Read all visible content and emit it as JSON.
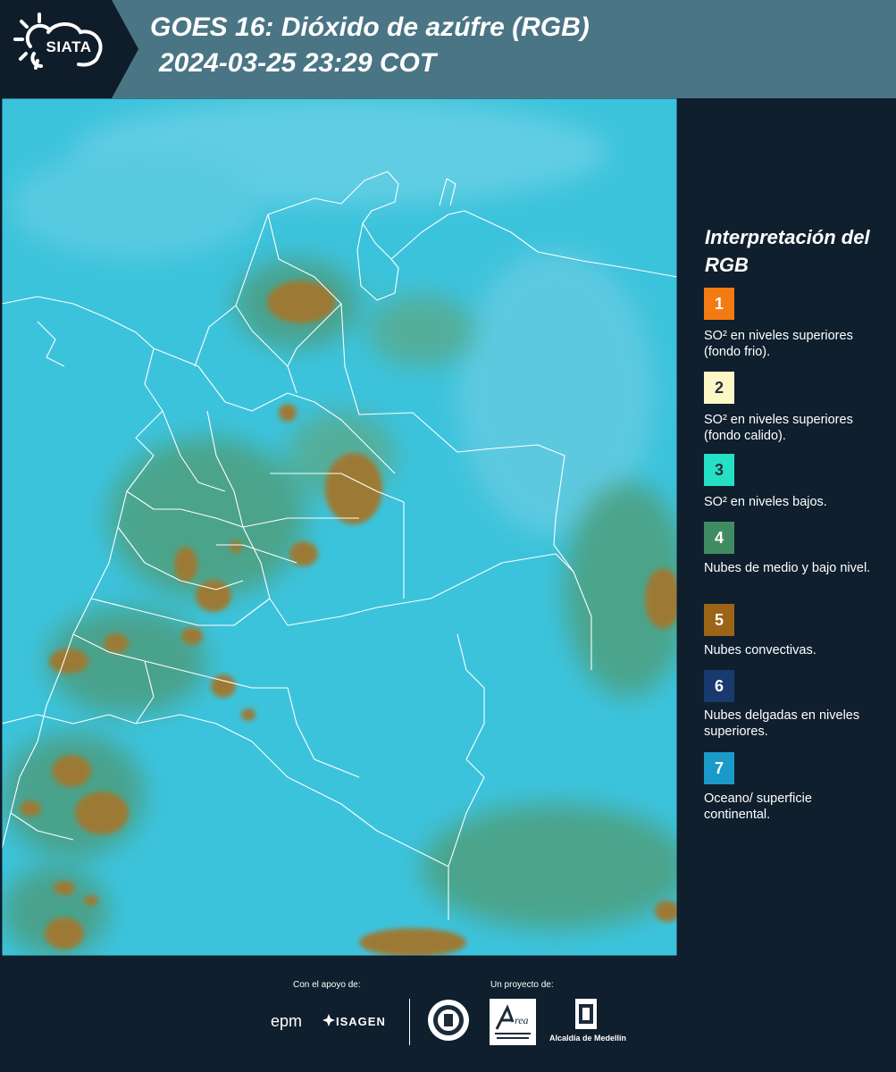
{
  "header": {
    "logo_text": "SIATA",
    "title_line1": "GOES 16: Dióxido de azúfre (RGB)",
    "title_line2": "2024-03-25 23:29 COT"
  },
  "legend": {
    "title": "Interpretación del RGB",
    "items": [
      {
        "number": "1",
        "label": "SO² en niveles superiores (fondo frio).",
        "color": "#f47a12"
      },
      {
        "number": "2",
        "label": "SO² en niveles superiores (fondo calido).",
        "color": "#fdf7c6"
      },
      {
        "number": "3",
        "label": "SO² en niveles bajos.",
        "color": "#25e0c4"
      },
      {
        "number": "4",
        "label": "Nubes de medio y bajo nivel.",
        "color": "#3f8c63"
      },
      {
        "number": "5",
        "label": "Nubes convectivas.",
        "color": "#9c6417"
      },
      {
        "number": "6",
        "label": "Nubes delgadas en niveles superiores.",
        "color": "#183a6e"
      },
      {
        "number": "7",
        "label": "Oceano/ superficie continental.",
        "color": "#1a9ac9"
      }
    ]
  },
  "footer": {
    "support_label": "Con el apoyo de:",
    "project_label": "Un proyecto de:",
    "sponsor_epm": "epm",
    "sponsor_isagen": "ISAGEN",
    "partner_area": "Área Metropolitana Valle de Aburrá",
    "partner_alcaldia": "Alcaldía de Medellín"
  },
  "map": {
    "ocean_land_color": "#3cc3dc",
    "convective_cloud_color": "#9c7a35",
    "mid_low_cloud_color": "#4d9a78",
    "border_color": "#ffffff"
  }
}
